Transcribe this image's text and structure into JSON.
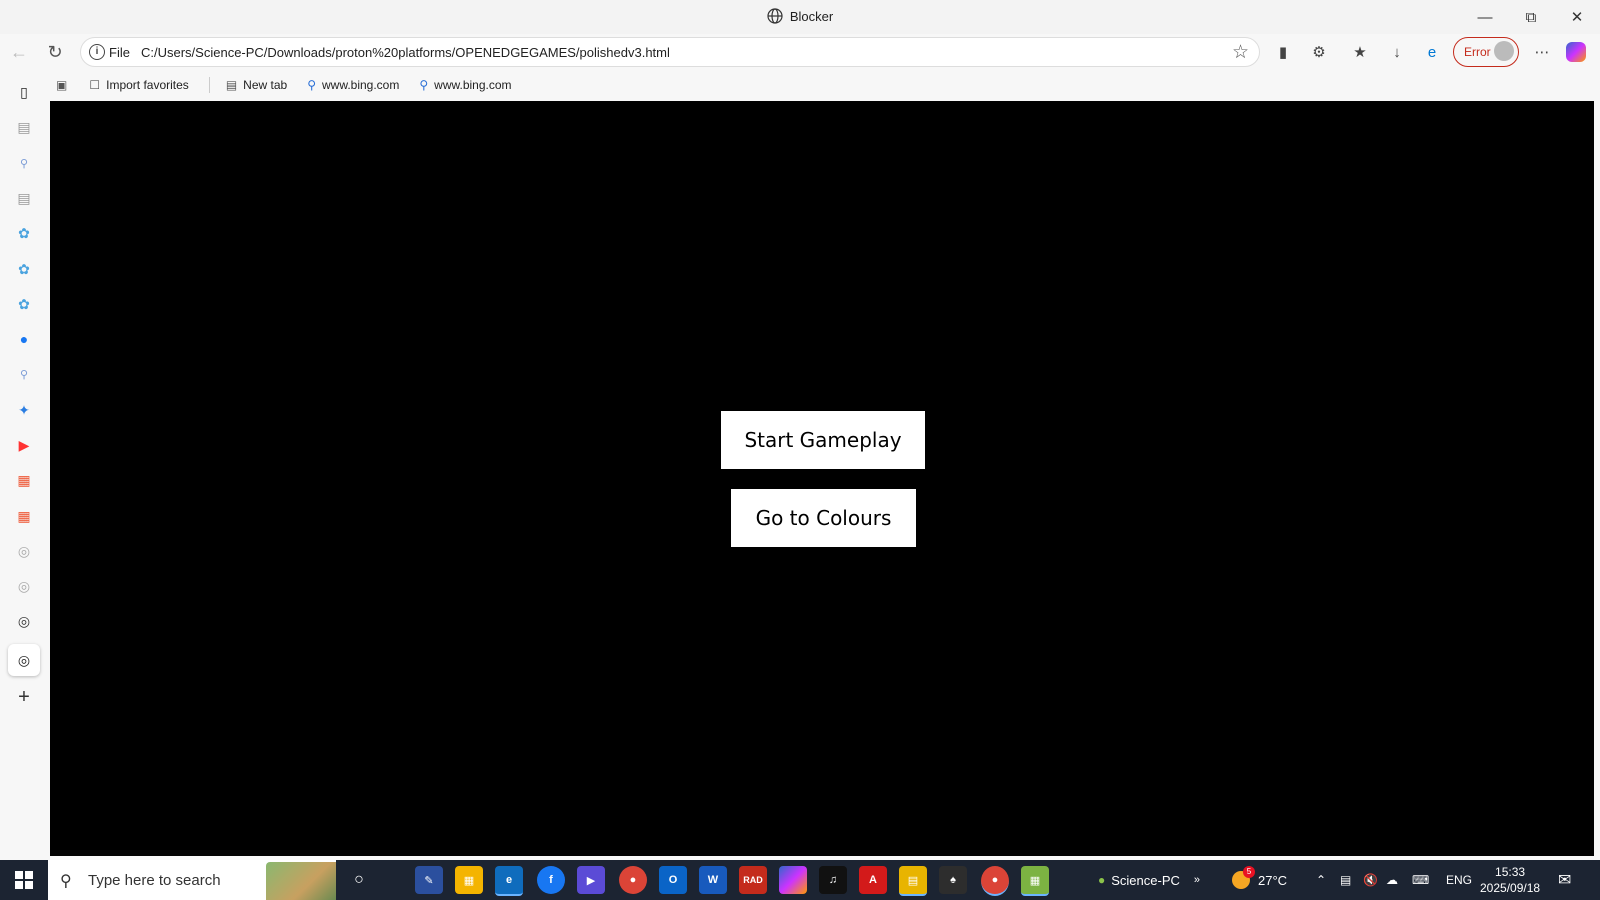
{
  "window": {
    "title": "Blocker"
  },
  "address_bar": {
    "scheme_label": "File",
    "url": "C:/Users/Science-PC/Downloads/proton%20platforms/OPENEDGEGAMES/polishedv3.html"
  },
  "profile": {
    "status_label": "Error"
  },
  "bookmarks": [
    {
      "label": "Import favorites",
      "icon": "import-icon"
    },
    {
      "label": "New tab",
      "icon": "new-tab-icon"
    },
    {
      "label": "www.bing.com",
      "icon": "search-icon"
    },
    {
      "label": "www.bing.com",
      "icon": "search-icon"
    }
  ],
  "game": {
    "start_button": "Start Gameplay",
    "colours_button": "Go to Colours"
  },
  "taskbar": {
    "search_placeholder": "Type here to search",
    "user_label": "Science-PC",
    "weather_temp": "27°C",
    "weather_badge": "5",
    "language": "ENG",
    "time": "15:33",
    "date": "2025/09/18"
  },
  "colors": {
    "accent": "#0078d4",
    "error": "#c42b1c",
    "taskbar": "#1c2432",
    "game_bg": "#000000"
  }
}
